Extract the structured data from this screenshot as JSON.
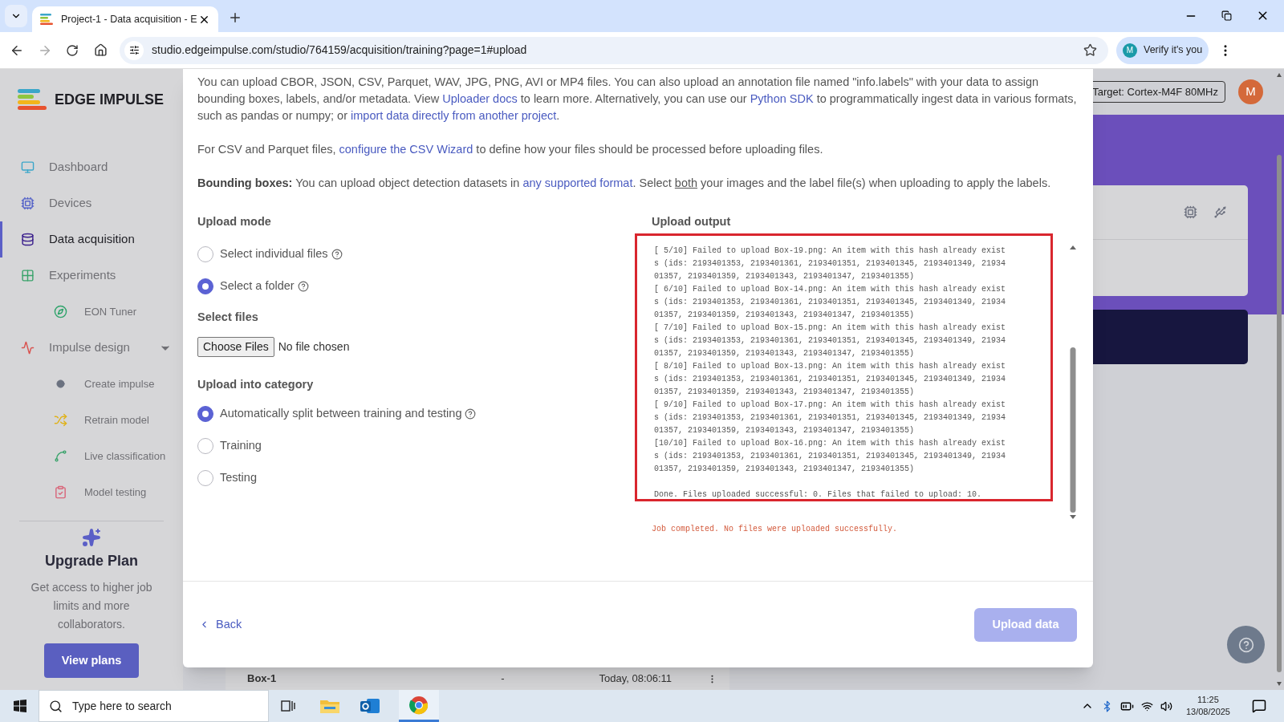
{
  "browser": {
    "tab_title": "Project-1 - Data acquisition - E",
    "url": "studio.edgeimpulse.com/studio/764159/acquisition/training?page=1#upload",
    "profile_label": "Verify it's you",
    "profile_initial": "M"
  },
  "sidebar": {
    "logo": "EDGE IMPULSE",
    "items": [
      {
        "label": "Dashboard",
        "kind": "monitor",
        "selected": false
      },
      {
        "label": "Devices",
        "kind": "chip",
        "selected": false
      },
      {
        "label": "Data acquisition",
        "kind": "database",
        "selected": true
      },
      {
        "label": "Experiments",
        "kind": "grid",
        "selected": false,
        "children": [
          {
            "label": "EON Tuner",
            "kind": "compass",
            "selected": false
          }
        ]
      },
      {
        "label": "Impulse design",
        "kind": "pulse",
        "selected": false,
        "expanded": true,
        "children": [
          {
            "label": "Create impulse",
            "kind": "dot",
            "selected": false
          },
          {
            "label": "Retrain model",
            "kind": "shuffle",
            "selected": false
          },
          {
            "label": "Live classification",
            "kind": "curve",
            "selected": false
          },
          {
            "label": "Model testing",
            "kind": "clipboard",
            "selected": false
          }
        ]
      }
    ],
    "upgrade": {
      "title": "Upgrade Plan",
      "text": "Get access to higher job limits and more collaborators.",
      "button": "View plans"
    }
  },
  "header": {
    "target": "Target: Cortex-M4F 80MHz",
    "avatar": "M"
  },
  "background_row": {
    "name": "Box-1",
    "label": "-",
    "date": "Today, 08:06:11"
  },
  "modal": {
    "paragraphs": [
      [
        {
          "kind": "text",
          "text": "You can upload CBOR, JSON, CSV, Parquet, WAV, JPG, PNG, AVI or MP4 files. You can also upload an annotation file named \"info.labels\" with your data to assign bounding boxes, labels, and/or metadata. View "
        },
        {
          "kind": "link",
          "text": "Uploader docs"
        },
        {
          "kind": "text",
          "text": " to learn more. Alternatively, you can use our "
        },
        {
          "kind": "link",
          "text": "Python SDK"
        },
        {
          "kind": "text",
          "text": " to programmatically ingest data in various formats, such as pandas or numpy; or "
        },
        {
          "kind": "link",
          "text": "import data directly from another project"
        },
        {
          "kind": "text",
          "text": "."
        }
      ],
      [
        {
          "kind": "text",
          "text": "For CSV and Parquet files, "
        },
        {
          "kind": "link",
          "text": "configure the CSV Wizard"
        },
        {
          "kind": "text",
          "text": " to define how your files should be processed before uploading files."
        }
      ],
      [
        {
          "kind": "bold",
          "text": "Bounding boxes:"
        },
        {
          "kind": "text",
          "text": " You can upload object detection datasets in "
        },
        {
          "kind": "link",
          "text": "any supported format"
        },
        {
          "kind": "text",
          "text": ". Select "
        },
        {
          "kind": "underline",
          "text": "both"
        },
        {
          "kind": "text",
          "text": " your images and the label file(s) when uploading to apply the labels."
        }
      ]
    ],
    "upload_mode": {
      "label": "Upload mode",
      "options": [
        {
          "label": "Select individual files",
          "selected": false,
          "help": true
        },
        {
          "label": "Select a folder",
          "selected": true,
          "help": true
        }
      ]
    },
    "select_files": {
      "label": "Select files",
      "button": "Choose Files",
      "status": "No file chosen"
    },
    "category": {
      "label": "Upload into category",
      "options": [
        {
          "label": "Automatically split between training and testing",
          "selected": true,
          "help": true
        },
        {
          "label": "Training",
          "selected": false,
          "help": false
        },
        {
          "label": "Testing",
          "selected": false,
          "help": false
        }
      ]
    },
    "output": {
      "title": "Upload output",
      "highlighted": true,
      "entries": [
        {
          "lines": [
            "[ 5/10] Failed to upload Box-19.png: An item with this hash already exist",
            "s (ids: 2193401353, 2193401361, 2193401351, 2193401345, 2193401349, 21934",
            "01357, 2193401359, 2193401343, 2193401347, 2193401355)"
          ]
        },
        {
          "lines": [
            "[ 6/10] Failed to upload Box-14.png: An item with this hash already exist",
            "s (ids: 2193401353, 2193401361, 2193401351, 2193401345, 2193401349, 21934",
            "01357, 2193401359, 2193401343, 2193401347, 2193401355)"
          ]
        },
        {
          "lines": [
            "[ 7/10] Failed to upload Box-15.png: An item with this hash already exist",
            "s (ids: 2193401353, 2193401361, 2193401351, 2193401345, 2193401349, 21934",
            "01357, 2193401359, 2193401343, 2193401347, 2193401355)"
          ]
        },
        {
          "lines": [
            "[ 8/10] Failed to upload Box-13.png: An item with this hash already exist",
            "s (ids: 2193401353, 2193401361, 2193401351, 2193401345, 2193401349, 21934",
            "01357, 2193401359, 2193401343, 2193401347, 2193401355)"
          ]
        },
        {
          "lines": [
            "[ 9/10] Failed to upload Box-17.png: An item with this hash already exist",
            "s (ids: 2193401353, 2193401361, 2193401351, 2193401345, 2193401349, 21934",
            "01357, 2193401359, 2193401343, 2193401347, 2193401355)"
          ]
        },
        {
          "lines": [
            "[10/10] Failed to upload Box-16.png: An item with this hash already exist",
            "s (ids: 2193401353, 2193401361, 2193401351, 2193401345, 2193401349, 21934",
            "01357, 2193401359, 2193401343, 2193401347, 2193401355)"
          ]
        }
      ],
      "summary": "Done. Files uploaded successful: 0. Files that failed to upload: 10.",
      "status": "Job completed. No files were uploaded successfully."
    },
    "back": "Back",
    "upload_button": {
      "label": "Upload data",
      "disabled": true
    }
  },
  "taskbar": {
    "search_placeholder": "Type here to search",
    "time": "11:25",
    "date": "13/08/2025"
  }
}
